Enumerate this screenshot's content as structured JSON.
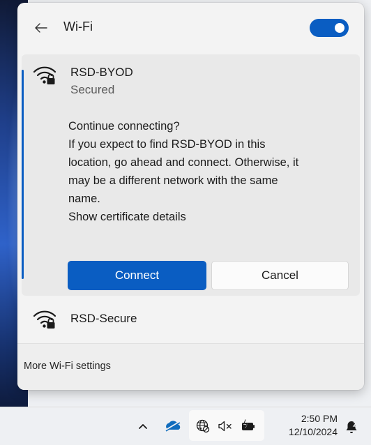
{
  "header": {
    "title": "Wi-Fi",
    "back_icon": "arrow-left-icon",
    "toggle_state": "on"
  },
  "selected_network": {
    "name": "RSD-BYOD",
    "status": "Secured",
    "prompt_lines": [
      "Continue connecting?",
      "If you expect to find RSD-BYOD in this",
      "location, go ahead and connect. Otherwise, it",
      "may be a different network with the same",
      "name.",
      "Show certificate details"
    ],
    "connect_label": "Connect",
    "cancel_label": "Cancel"
  },
  "networks": [
    {
      "name": "RSD-Secure",
      "icon": "wifi-secured-icon"
    }
  ],
  "footer": {
    "link": "More Wi-Fi settings"
  },
  "taskbar": {
    "time": "2:50 PM",
    "date": "12/10/2024",
    "icons": [
      "chevron-up-icon",
      "onedrive-icon",
      "globe-no-internet-icon",
      "volume-muted-icon",
      "battery-charging-icon",
      "notification-icon"
    ]
  },
  "colors": {
    "accent": "#0a5dc2",
    "panel_bg": "#f3f3f3",
    "card_bg": "#e9e9e9"
  }
}
